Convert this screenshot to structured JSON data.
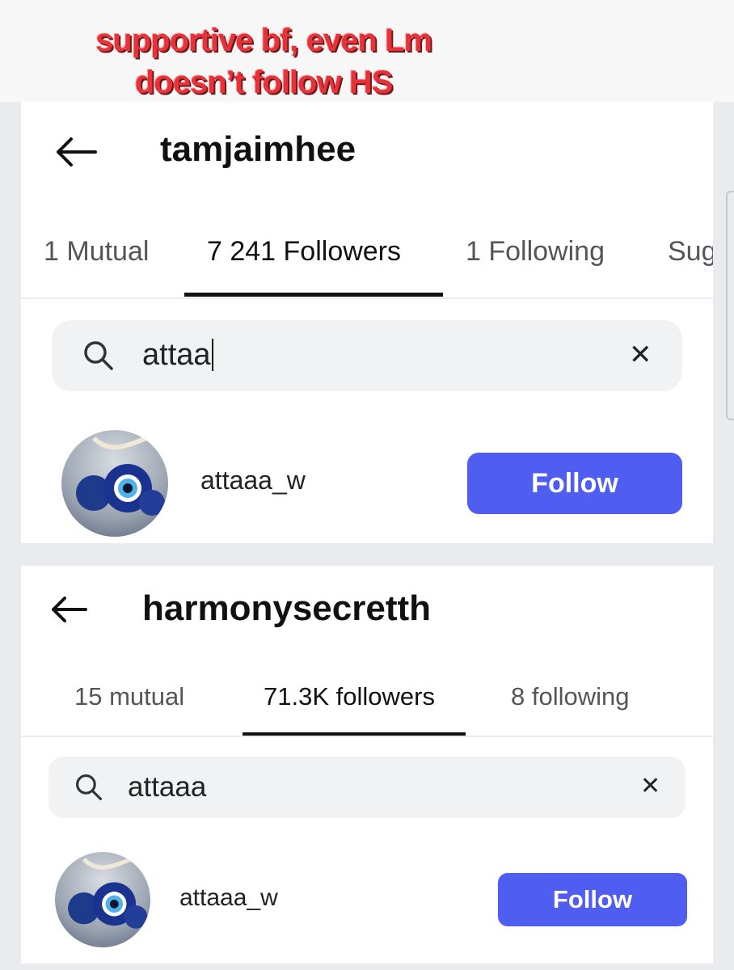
{
  "caption": {
    "line1": "supportive bf, even Lm",
    "line2": "doesn’t follow HS"
  },
  "panel1": {
    "back_icon": "arrow-left-icon",
    "handle": "tamjaimhee",
    "tabs": [
      {
        "label": "1 Mutual",
        "active": false
      },
      {
        "label": "7 241 Followers",
        "active": true
      },
      {
        "label": "1 Following",
        "active": false
      },
      {
        "label": "Sug",
        "active": false
      }
    ],
    "search": {
      "icon": "search-icon",
      "value": "attaa",
      "clear_icon": "close-icon"
    },
    "result": {
      "avatar": "evil-eye-avatar",
      "username": "attaaa_w",
      "button": "Follow"
    }
  },
  "panel2": {
    "back_icon": "arrow-left-icon",
    "handle": "harmonysecretth",
    "tabs": [
      {
        "label": "15 mutual",
        "active": false
      },
      {
        "label": "71.3K followers",
        "active": true
      },
      {
        "label": "8 following",
        "active": false
      }
    ],
    "search": {
      "icon": "search-icon",
      "value": "attaaa",
      "clear_icon": "close-icon"
    },
    "result": {
      "avatar": "evil-eye-avatar",
      "username": "attaaa_w",
      "button": "Follow"
    }
  },
  "colors": {
    "accent": "#4f5ef0",
    "caption": "#e8323a"
  }
}
